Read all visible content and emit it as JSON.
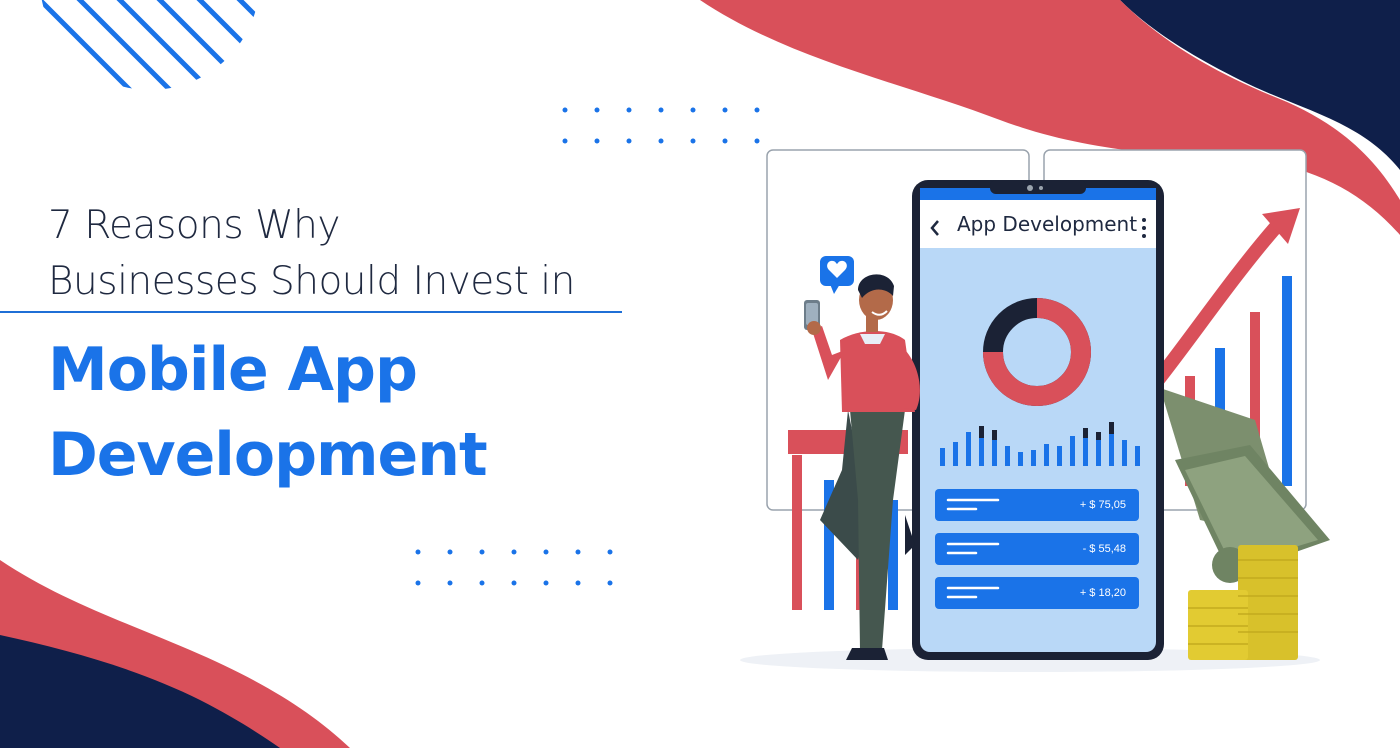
{
  "headline": {
    "line1": "7 Reasons Why",
    "line2": "Businesses Should Invest in",
    "highlight_line1": "Mobile App",
    "highlight_line2": "Development"
  },
  "phone": {
    "title": "App Development",
    "transactions": [
      {
        "amount": "+ $ 75,05"
      },
      {
        "amount": "- $ 55,48"
      },
      {
        "amount": "+ $ 18,20"
      }
    ]
  },
  "colors": {
    "accent_blue": "#1a73e8",
    "red": "#d9505a",
    "navy": "#0f1f4a",
    "screen_blue": "#b9d8f7"
  }
}
